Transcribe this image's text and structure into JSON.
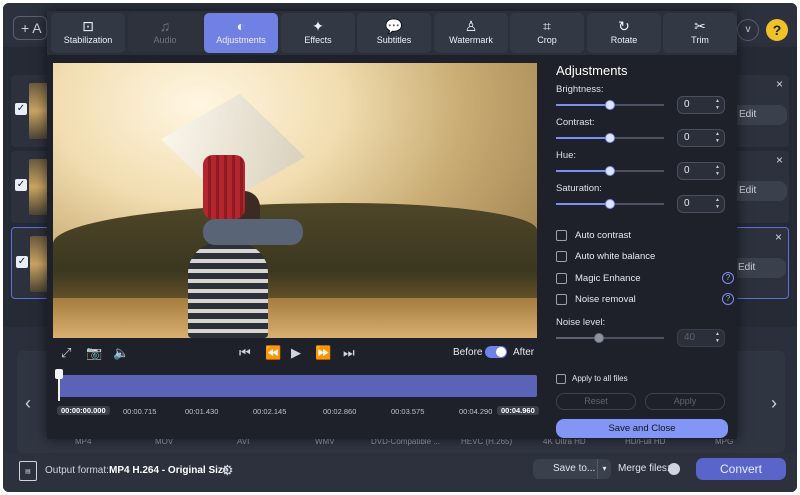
{
  "app": {
    "add_label": "+ A",
    "help_label": "?",
    "chevron_label": "v",
    "edit_label": "Edit",
    "close_label": "×",
    "check_mark": "✓",
    "format_labels": [
      "MP4",
      "MOV",
      "AVI",
      "WMV",
      "DVD-Compatible ...",
      "HEVC (H.265)",
      "4K Ultra HD",
      "HD/Full HD",
      "MPG"
    ],
    "output_label": "Output format:",
    "output_value": "MP4 H.264 - Original Size",
    "save_to_label": "Save to...",
    "merge_label": "Merge files:",
    "convert_label": "Convert"
  },
  "toolbar": {
    "items": [
      {
        "label": "Stabilization",
        "icon": "stabilization-icon",
        "glyph": "⊡"
      },
      {
        "label": "Audio",
        "icon": "music-note-icon",
        "glyph": "♫"
      },
      {
        "label": "Adjustments",
        "icon": "contrast-icon",
        "glyph": "◐"
      },
      {
        "label": "Effects",
        "icon": "magic-wand-icon",
        "glyph": "✦"
      },
      {
        "label": "Subtitles",
        "icon": "speech-bubble-icon",
        "glyph": "💬"
      },
      {
        "label": "Watermark",
        "icon": "stamp-icon",
        "glyph": "♙"
      },
      {
        "label": "Crop",
        "icon": "crop-icon",
        "glyph": "⌗"
      },
      {
        "label": "Rotate",
        "icon": "rotate-icon",
        "glyph": "↻"
      },
      {
        "label": "Trim",
        "icon": "scissors-icon",
        "glyph": "✂"
      }
    ],
    "active": "Adjustments",
    "disabled": "Audio"
  },
  "player": {
    "before_label": "Before",
    "after_label": "After",
    "timeline": {
      "position_fraction": 0.0,
      "labels": [
        "00:00:00.000",
        "00:00.715",
        "00:01.430",
        "00:02.145",
        "00:02.860",
        "00:03.575",
        "00:04.290",
        "00:04.960"
      ]
    }
  },
  "adjustments": {
    "title": "Adjustments",
    "sliders": [
      {
        "label": "Brightness:",
        "value": "0",
        "level": 0.5
      },
      {
        "label": "Contrast:",
        "value": "0",
        "level": 0.5
      },
      {
        "label": "Hue:",
        "value": "0",
        "level": 0.5
      },
      {
        "label": "Saturation:",
        "value": "0",
        "level": 0.5
      }
    ],
    "checkboxes": [
      {
        "label": "Auto contrast",
        "help": false
      },
      {
        "label": "Auto white balance",
        "help": false
      },
      {
        "label": "Magic Enhance",
        "help": true
      },
      {
        "label": "Noise removal",
        "help": true
      }
    ],
    "help_glyph": "?",
    "noise": {
      "label": "Noise level:",
      "value": "40",
      "level": 0.4
    },
    "apply_all_label": "Apply to all files",
    "reset_label": "Reset",
    "apply_label": "Apply",
    "save_close_label": "Save and Close"
  }
}
